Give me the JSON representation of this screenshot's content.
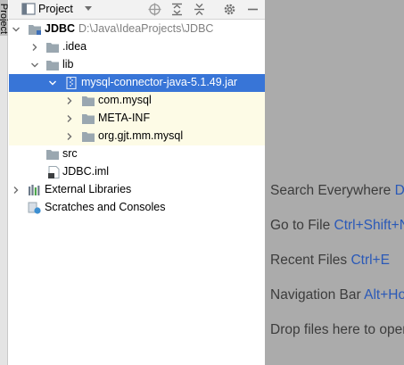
{
  "side_tab": {
    "label": "Project"
  },
  "toolbar": {
    "title": "Project",
    "icons": [
      "project-icon",
      "dropdown-chevron-icon",
      "locate-icon",
      "expand-all-icon",
      "collapse-all-icon",
      "gear-icon",
      "minimize-icon"
    ]
  },
  "tree": {
    "root": {
      "name": "JDBC",
      "path": "D:\\Java\\IdeaProjects\\JDBC"
    },
    "idea": ".idea",
    "lib": "lib",
    "jar": "mysql-connector-java-5.1.49.jar",
    "jar_children": [
      "com.mysql",
      "META-INF",
      "org.gjt.mm.mysql"
    ],
    "src": "src",
    "iml": "JDBC.iml",
    "external_libraries": "External Libraries",
    "scratches": "Scratches and Consoles"
  },
  "editor": {
    "hints": [
      {
        "text": "Search Everywhere ",
        "key": "Double Shift"
      },
      {
        "text": "Go to File ",
        "key": "Ctrl+Shift+N"
      },
      {
        "text": "Recent Files ",
        "key": "Ctrl+E"
      },
      {
        "text": "Navigation Bar ",
        "key": "Alt+Home"
      },
      {
        "text": "Drop files here to open",
        "key": ""
      }
    ]
  },
  "colors": {
    "selection": "#3875d7",
    "library_highlight": "#fdfbe6",
    "editor_background": "#ababab",
    "shortcut": "#2a59b8",
    "folder": "#9aa7b0"
  }
}
